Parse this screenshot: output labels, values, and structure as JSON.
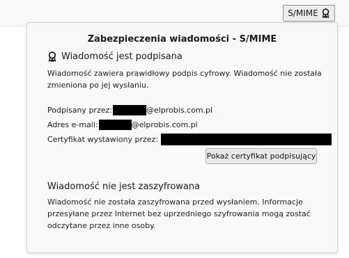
{
  "toolbar": {
    "smime_label": "S/MIME",
    "smime_icon": "ribbon-seal-icon"
  },
  "panel": {
    "title": "Zabezpieczenia wiadomości - S/MIME",
    "signature": {
      "icon": "ribbon-seal-icon",
      "heading": "Wiadomość jest podpisana",
      "description_line1": "Wiadomość zawiera prawidłowy podpis cyfrowy. Wiadomość nie została",
      "description_line2": "zmieniona po jej wysłaniu.",
      "signed_by_label": "Podpisany przez:",
      "signed_by_domain": "@elprobis.com.pl",
      "email_label": "Adres e-mail:",
      "email_domain": "@elprobis.com.pl",
      "issuer_label": "Certyfikat wystawiony przez:",
      "show_cert_button": "Pokaż certyfikat podpisujący"
    },
    "encryption": {
      "heading": "Wiadomość nie jest zaszyfrowana",
      "description_line1": "Wiadomość nie została zaszyfrowana przed wysłaniem. Informacje",
      "description_line2": "przesyłane przez Internet bez uprzedniego szyfrowania mogą zostać",
      "description_line3": "odczytane przez inne osoby."
    }
  },
  "colors": {
    "redaction": "#000000",
    "panel_bg": "#f9f9fa",
    "button_bg": "#e9e9ed"
  }
}
